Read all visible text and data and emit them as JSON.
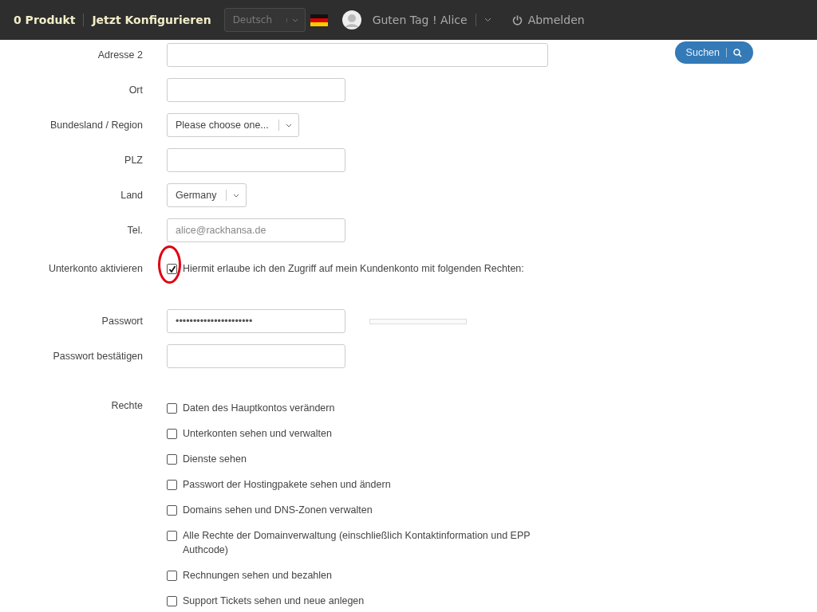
{
  "header": {
    "cart": "0 Produkt",
    "configure": "Jetzt Konfigurieren",
    "language": "Deutsch",
    "greeting": "Guten Tag ! Alice",
    "logout": "Abmelden"
  },
  "search_button": "Suchen",
  "fields": [
    {
      "kind": "long",
      "label": "Adresse 2"
    },
    {
      "kind": "input",
      "label": "Ort"
    },
    {
      "kind": "select",
      "label": "Bundesland / Region",
      "value": "Please choose one..."
    },
    {
      "kind": "input",
      "label": "PLZ"
    },
    {
      "kind": "select",
      "label": "Land",
      "value": "Germany"
    },
    {
      "kind": "input",
      "label": "Tel.",
      "placeholder": "alice@rackhansa.de"
    }
  ],
  "subaccount": {
    "label": "Unterkonto aktivieren",
    "checked": true,
    "text": "Hiermit erlaube ich den Zugriff auf mein Kundenkonto mit folgenden Rechten:"
  },
  "password": {
    "label": "Passwort",
    "value": "••••••••••••••••••••••",
    "strength": {
      "level": 0
    }
  },
  "password_confirm": {
    "label": "Passwort bestätigen"
  },
  "rights": {
    "label": "Rechte",
    "items": [
      {
        "text": "Daten des Hauptkontos verändern",
        "checked": false
      },
      {
        "text": "Unterkonten sehen und verwalten",
        "checked": false
      },
      {
        "text": "Dienste sehen",
        "checked": false
      },
      {
        "text": "Passwort der Hostingpakete sehen und ändern",
        "checked": false
      },
      {
        "text": "Domains sehen und DNS-Zonen verwalten",
        "checked": false
      },
      {
        "text": "Alle Rechte der Domainverwaltung (einschließlich Kontaktinformation und EPP Authcode)",
        "checked": false
      },
      {
        "text": "Rechnungen sehen und bezahlen",
        "checked": false
      },
      {
        "text": "Support Tickets sehen und neue anlegen",
        "checked": false
      }
    ]
  }
}
